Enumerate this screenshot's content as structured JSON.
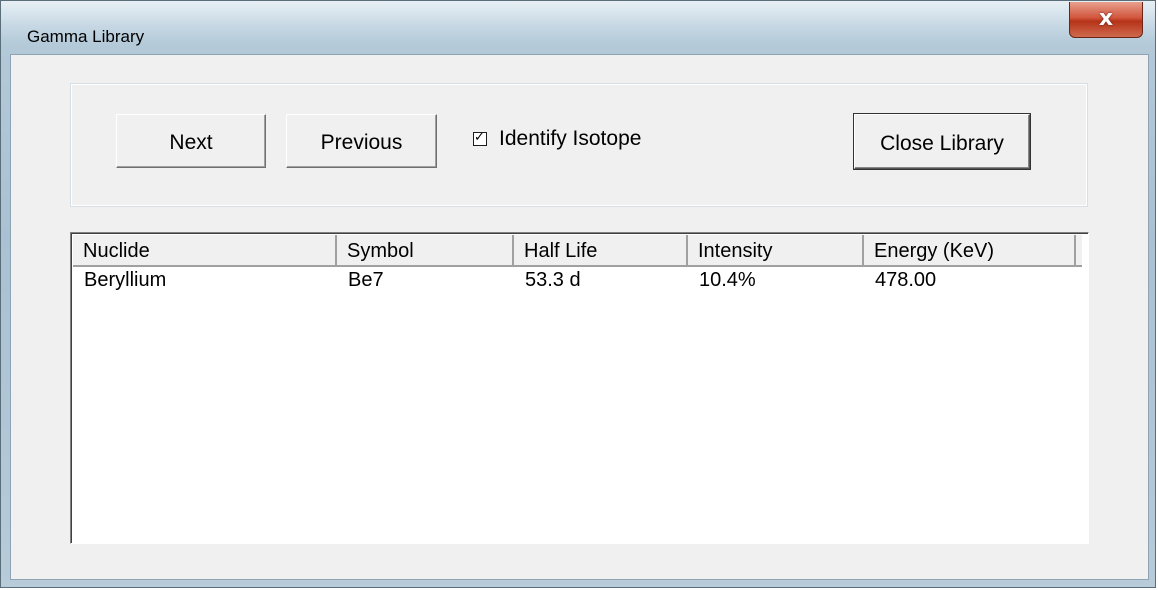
{
  "window": {
    "title": "Gamma Library",
    "close_glyph": "x"
  },
  "toolbar": {
    "next_label": "Next",
    "previous_label": "Previous",
    "identify_label": "Identify Isotope",
    "identify_checked": true,
    "close_library_label": "Close Library"
  },
  "table": {
    "columns": [
      "Nuclide",
      "Symbol",
      "Half Life",
      "Intensity",
      "Energy (KeV)"
    ],
    "rows": [
      [
        "Beryllium",
        "Be7",
        "53.3 d",
        "10.4%",
        "478.00"
      ]
    ]
  }
}
